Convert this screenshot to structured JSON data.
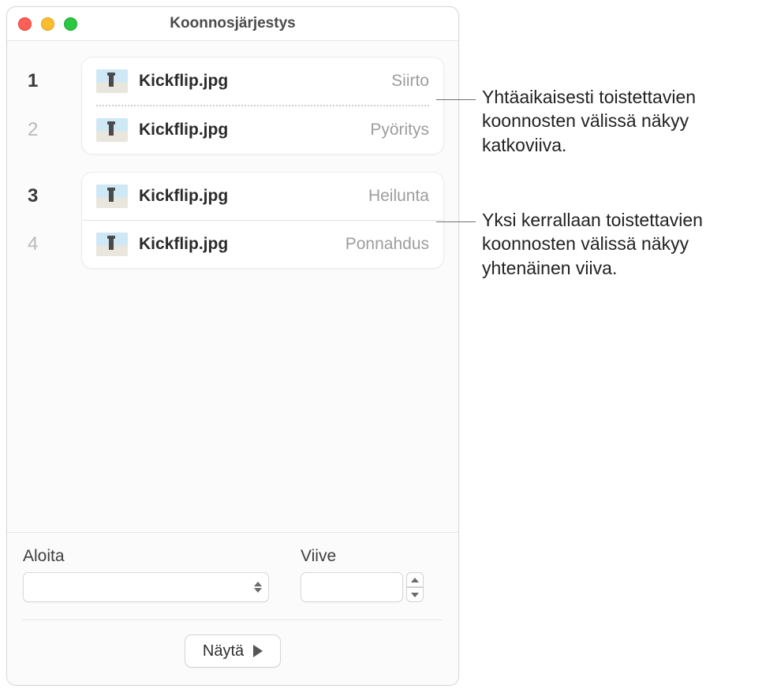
{
  "window": {
    "title": "Koonnosjärjestys"
  },
  "groups": [
    {
      "rows": [
        {
          "num": "1",
          "num_bold": true,
          "file": "Kickflip.jpg",
          "effect": "Siirto"
        },
        {
          "num": "2",
          "num_bold": false,
          "file": "Kickflip.jpg",
          "effect": "Pyöritys"
        }
      ],
      "divider": "dotted"
    },
    {
      "rows": [
        {
          "num": "3",
          "num_bold": true,
          "file": "Kickflip.jpg",
          "effect": "Heilunta"
        },
        {
          "num": "4",
          "num_bold": false,
          "file": "Kickflip.jpg",
          "effect": "Ponnahdus"
        }
      ],
      "divider": "solid"
    }
  ],
  "bottom": {
    "start_label": "Aloita",
    "delay_label": "Viive",
    "show_label": "Näytä"
  },
  "callouts": {
    "dotted": "Yhtäaikaisesti toistettavien koonnosten välissä näkyy katkoviiva.",
    "solid": "Yksi kerrallaan toistettavien koonnosten välissä näkyy yhtenäinen viiva."
  }
}
